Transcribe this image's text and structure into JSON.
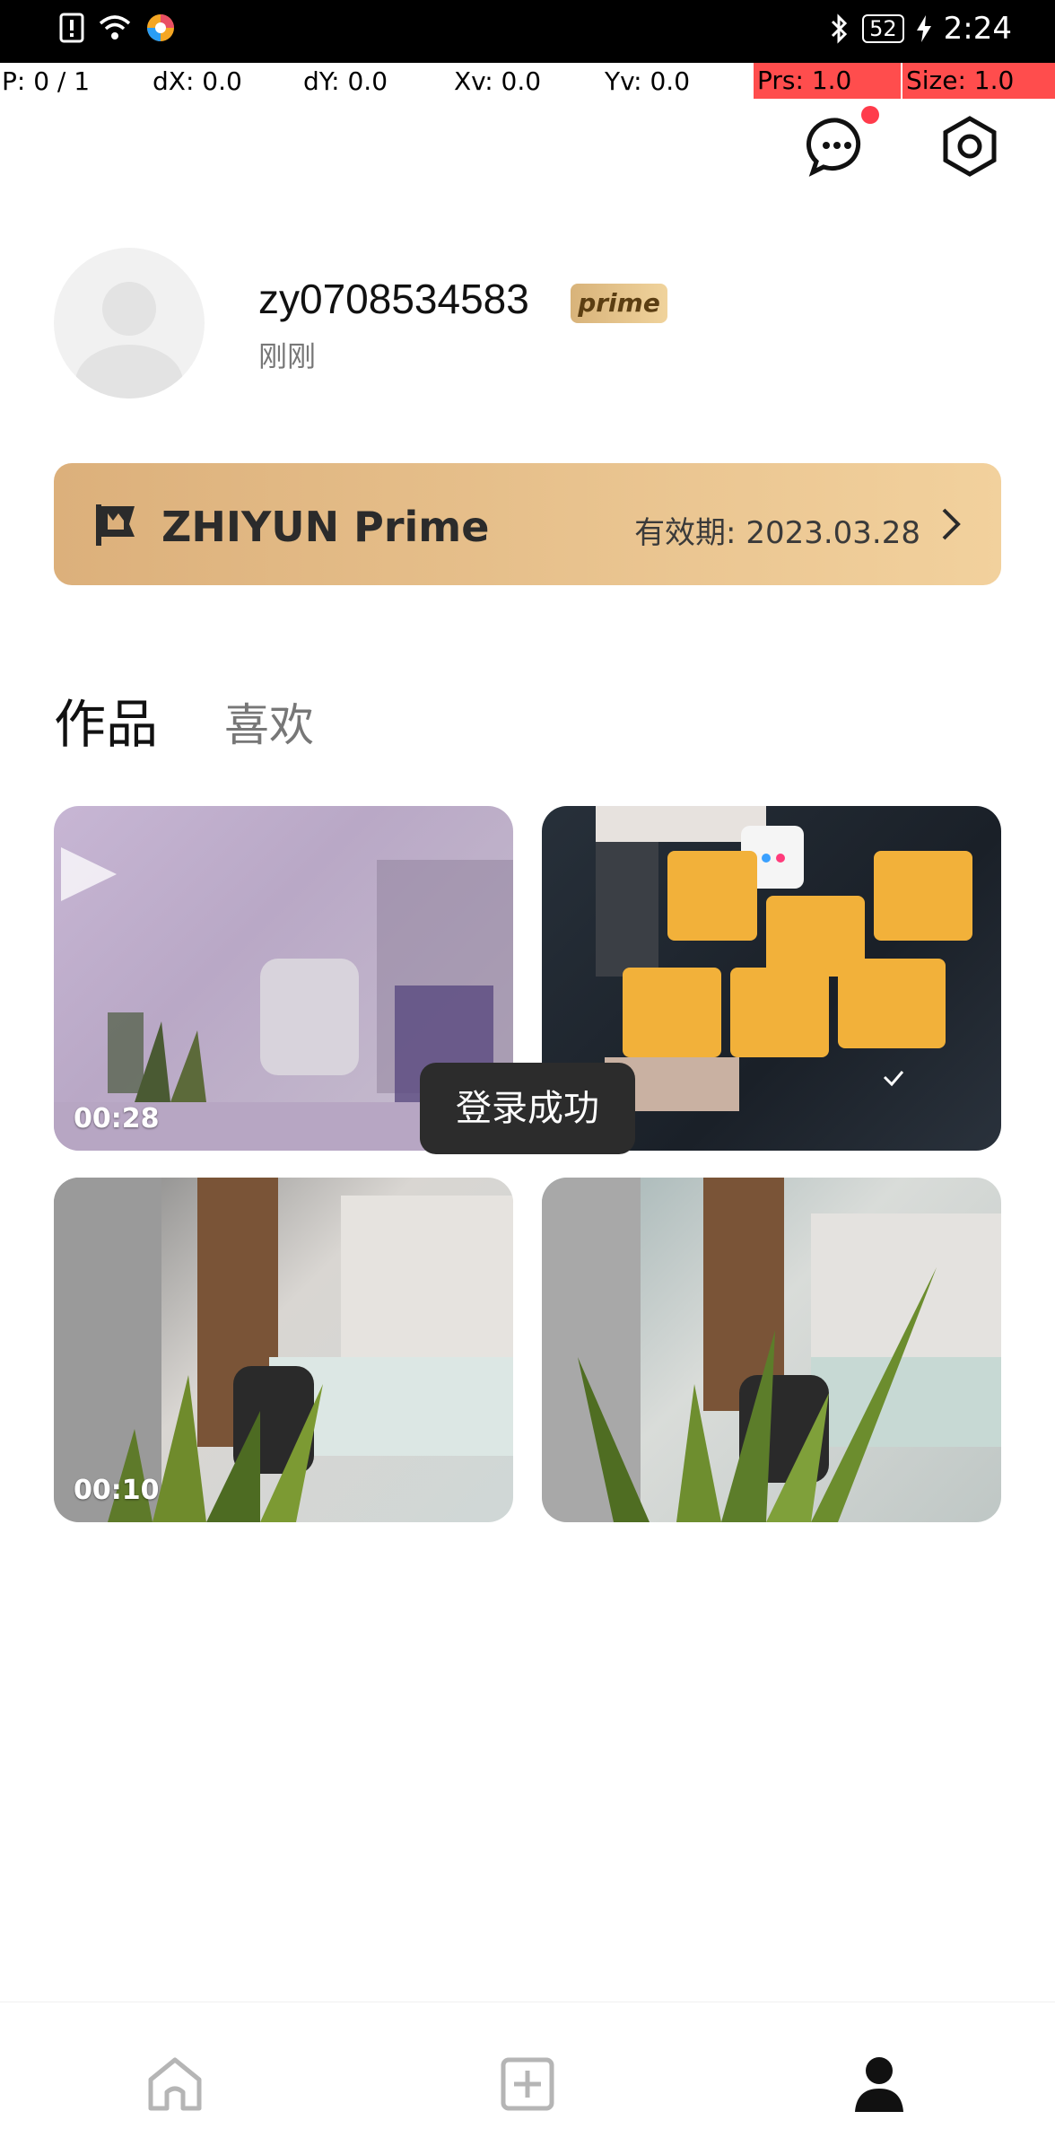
{
  "status_bar": {
    "time": "2:24",
    "battery": "52",
    "icons": [
      "sim-alert-icon",
      "wifi-icon",
      "app-icon",
      "bluetooth-icon",
      "battery-icon",
      "charging-icon"
    ]
  },
  "debug_overlay": {
    "p": "P: 0 / 1",
    "dx": "dX: 0.0",
    "dy": "dY: 0.0",
    "xv": "Xv: 0.0",
    "yv": "Yv: 0.0",
    "prs": "Prs: 1.0",
    "size": "Size: 1.0"
  },
  "profile": {
    "username": "zy0708534583",
    "badge": "prime",
    "last_active": "刚刚"
  },
  "prime_card": {
    "title": "ZHIYUN Prime",
    "validity": "有效期: 2023.03.28"
  },
  "tabs": [
    {
      "label": "作品",
      "active": true
    },
    {
      "label": "喜欢",
      "active": false
    }
  ],
  "videos": [
    {
      "duration": "00:28"
    },
    {
      "duration": ""
    },
    {
      "duration": "00:10"
    },
    {
      "duration": ""
    }
  ],
  "toast": {
    "text": "登录成功"
  },
  "bottom_nav": [
    "home-icon",
    "add-icon",
    "profile-icon"
  ],
  "colors": {
    "accent": "#ff3b4b",
    "prime_gold": "#dcb07b"
  }
}
